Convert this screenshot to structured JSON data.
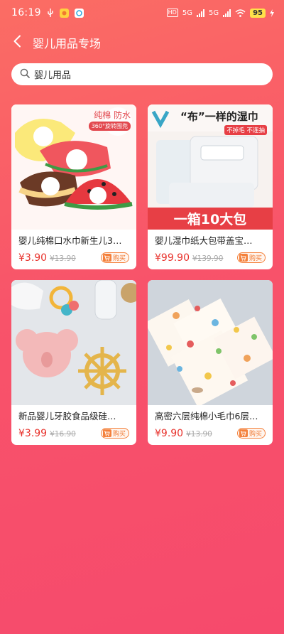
{
  "status_bar": {
    "time": "16:19",
    "network_1": "5G",
    "network_2": "5G",
    "battery": "95"
  },
  "header": {
    "back_icon": "chevron-left-icon",
    "title": "婴儿用品专场"
  },
  "search": {
    "icon": "search-icon",
    "value": "婴儿用品"
  },
  "products": [
    {
      "title": "婴儿纯棉口水巾新生儿3…",
      "price": "¥3.90",
      "original_price": "¥13.90",
      "buy_label": "购买",
      "image_text_1": "纯棉 防水",
      "image_text_2": "360°旋转围兜"
    },
    {
      "title": "婴儿湿巾纸大包带盖宝…",
      "price": "¥99.90",
      "original_price": "¥139.90",
      "buy_label": "购买",
      "image_text_1": "“布”一样的湿巾",
      "image_text_2": "不掉毛 不连抽",
      "image_text_3": "一箱10大包"
    },
    {
      "title": "新品婴儿牙胶食品级硅…",
      "price": "¥3.99",
      "original_price": "¥16.90",
      "buy_label": "购买"
    },
    {
      "title": "高密六层纯棉小毛巾6层…",
      "price": "¥9.90",
      "original_price": "¥13.90",
      "buy_label": "购买"
    }
  ],
  "colors": {
    "background_top": "#fb6d64",
    "background_bottom": "#f64a6c",
    "price": "#e8322c",
    "buy_button": "#f4803b"
  }
}
